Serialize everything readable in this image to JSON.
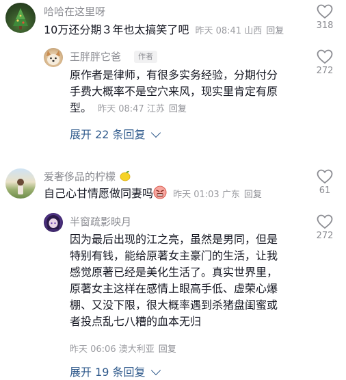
{
  "comments": [
    {
      "username": "哈哈在这里呀",
      "text": "10万还分期３年也太搞笑了吧",
      "time": "昨天 08:41",
      "location": "山西",
      "reply_label": "回复",
      "likes": "318",
      "avatar_icon": "christmas-tree-avatar"
    },
    {
      "username": "王胖胖它爸",
      "badge": "作者",
      "text_lines": [
        "原作者是律师，有很多实务经验，分期付分",
        "手费大概率不是空穴来风，现实里肯定有原",
        "型。"
      ],
      "time": "昨天 08:47",
      "location": "江苏",
      "reply_label": "回复",
      "likes": "272",
      "avatar_icon": "corgi-avatar"
    },
    {
      "username": "爱奢侈品的柠檬",
      "name_emoji": "lemon-icon",
      "text": "自己心甘情愿做同妻吗",
      "text_emoji": "angry-face-icon",
      "time": "昨天 01:03",
      "location": "广东",
      "reply_label": "回复",
      "likes": "61",
      "avatar_icon": "field-photo-avatar"
    },
    {
      "username": "半窗疏影映月",
      "text_lines": [
        "因为最后出现的江之亮，虽然是男同，但是",
        "特别有钱，能给原著女主豪门的生活，让我",
        "感觉原著已经是美化生活了。真实世界里，",
        "原著女主这样在感情上眼高手低、虚荣心爆",
        "棚、又没下限，很大概率遇到杀猪盘闺蜜或",
        "者投点乱七八糟的血本无归"
      ],
      "time": "昨天 06:06",
      "location": "澳大利亚",
      "reply_label": "回复",
      "likes": "272",
      "avatar_icon": "anime-avatar"
    }
  ],
  "expand_1": "展开 22 条回复",
  "expand_2": "展开 19 条回复",
  "colors": {
    "link": "#2f5a8c",
    "muted": "#8a8b91",
    "text": "#161823"
  }
}
